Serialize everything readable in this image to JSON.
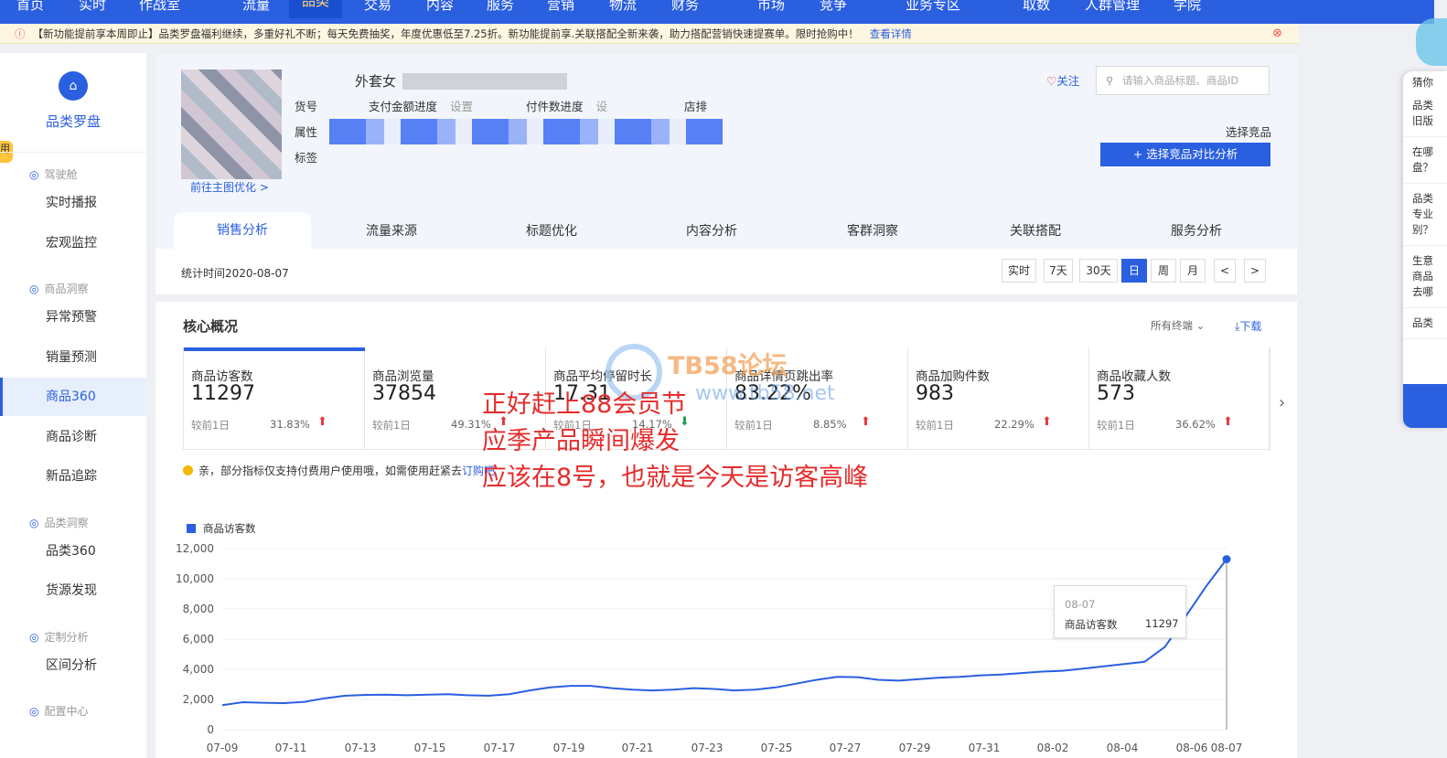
{
  "topnav": {
    "items": [
      "首页",
      "实时",
      "作战室",
      "流量",
      "品类",
      "交易",
      "内容",
      "服务",
      "营销",
      "物流",
      "财务",
      "市场",
      "竞争",
      "业务专区",
      "取数",
      "人群管理",
      "学院"
    ],
    "active": "品类"
  },
  "notice": {
    "text": "【新功能提前享本周即止】品类罗盘福利继续，多重好礼不断；每天免费抽奖，年度优惠低至7.25折。新功能提前享.关联搭配全新来袭，助力搭配营销快速提赛单。限时抢购中！",
    "link": "查看详情"
  },
  "sidebar": {
    "logo": "品类罗盘",
    "groups": [
      {
        "label": "驾驶舱",
        "items": [
          "实时播报",
          "宏观监控"
        ]
      },
      {
        "label": "商品洞察",
        "items": [
          "异常预警",
          "销量预测",
          "商品360",
          "商品诊断",
          "新品追踪"
        ]
      },
      {
        "label": "品类洞察",
        "items": [
          "品类360",
          "货源发现"
        ]
      },
      {
        "label": "定制分析",
        "items": [
          "区间分析"
        ]
      },
      {
        "label": "配置中心",
        "items": []
      }
    ],
    "active": "商品360",
    "tab_badge": "用"
  },
  "product": {
    "title": "外套女",
    "fields": {
      "sku_label": "货号",
      "pay_progress": "支付金额进度",
      "setting1": "设置",
      "qty_progress": "付件数进度",
      "setting2": "设",
      "rank": "店排",
      "attr_label": "属性",
      "tag_label": "标签"
    },
    "main_pic_link": "前往主图优化 >",
    "follow": "关注",
    "search_placeholder": "请输入商品标题、商品ID",
    "choose_label": "选择竞品",
    "choose_button": "+ 选择竞品对比分析"
  },
  "tabs": [
    "销售分析",
    "流量来源",
    "标题优化",
    "内容分析",
    "客群洞察",
    "关联搭配",
    "服务分析"
  ],
  "stat_time": "统计时间2020-08-07",
  "ranges": [
    "实时",
    "7天",
    "30天",
    "日",
    "周",
    "月",
    "<",
    ">"
  ],
  "range_active": "日",
  "core": {
    "title": "核心概况",
    "terminal": "所有终端",
    "download": "下载",
    "metrics": [
      {
        "name": "商品访客数",
        "value": "11297",
        "cmp": "较前1日",
        "pct": "31.83%",
        "dir": "up"
      },
      {
        "name": "商品浏览量",
        "value": "37854",
        "cmp": "较前1日",
        "pct": "49.31%",
        "dir": "up"
      },
      {
        "name": "商品平均停留时长",
        "value": "17.31",
        "cmp": "较前1日",
        "pct": "14.17%",
        "dir": "down"
      },
      {
        "name": "商品详情页跳出率",
        "value": "83.22%",
        "cmp": "较前1日",
        "pct": "8.85%",
        "dir": "up"
      },
      {
        "name": "商品加购件数",
        "value": "983",
        "cmp": "较前1日",
        "pct": "22.29%",
        "dir": "up"
      },
      {
        "name": "商品收藏人数",
        "value": "573",
        "cmp": "较前1日",
        "pct": "36.62%",
        "dir": "up"
      }
    ],
    "tip": "亲，部分指标仅支持付费用户使用哦，如需使用赶紧去",
    "tip_link": "订购吧"
  },
  "overlay": {
    "line1": "正好赶上88会员节",
    "line2": "应季产品瞬间爆发",
    "line3": "应该在8号，也就是今天是访客高峰",
    "watermark": "TB58论坛",
    "watermark2": "www.tb58.net"
  },
  "right_panel": {
    "lines": [
      "猜你",
      "品类旧版",
      "在哪盘？",
      "品类专业别？",
      "生意商品去哪",
      "品类"
    ]
  },
  "tooltip": {
    "date": "08-07",
    "name": "商品访客数",
    "value": "11297"
  },
  "colors": {
    "primary": "#2a5fe0",
    "up": "#e4393c",
    "down": "#2a9d4a",
    "overlay": "#e52b2b"
  },
  "chart_data": {
    "type": "line",
    "series": [
      {
        "name": "商品访客数",
        "values": [
          1620,
          1820,
          1780,
          1760,
          1840,
          2080,
          2250,
          2300,
          2320,
          2280,
          2320,
          2350,
          2280,
          2250,
          2350,
          2600,
          2800,
          2900,
          2900,
          2750,
          2650,
          2600,
          2650,
          2750,
          2700,
          2600,
          2650,
          2800,
          3050,
          3300,
          3500,
          3480,
          3300,
          3250,
          3350,
          3450,
          3500,
          3600,
          3650,
          3750,
          3850,
          3900,
          4050,
          4200,
          4350,
          4500,
          5500,
          7500,
          9500,
          11297
        ]
      }
    ],
    "x": [
      "07-09",
      "07-10",
      "07-11",
      "07-12",
      "07-13",
      "07-14",
      "07-15",
      "07-16",
      "07-17",
      "07-18",
      "07-19",
      "07-20",
      "07-21",
      "07-22",
      "07-23",
      "07-24",
      "07-25",
      "07-26",
      "07-27",
      "07-28",
      "07-29",
      "07-30",
      "07-31",
      "08-01",
      "08-02",
      "08-03",
      "08-04",
      "08-05",
      "08-06",
      "08-07"
    ],
    "xticks": [
      "07-09",
      "07-11",
      "07-13",
      "07-15",
      "07-17",
      "07-19",
      "07-21",
      "07-23",
      "07-25",
      "07-27",
      "07-29",
      "07-31",
      "08-02",
      "08-04",
      "08-06",
      "08-07"
    ],
    "yticks": [
      "12,000",
      "10,000",
      "8,000",
      "6,000",
      "4,000",
      "2,000",
      "0"
    ],
    "ylim": [
      0,
      12000
    ],
    "grid": true
  }
}
